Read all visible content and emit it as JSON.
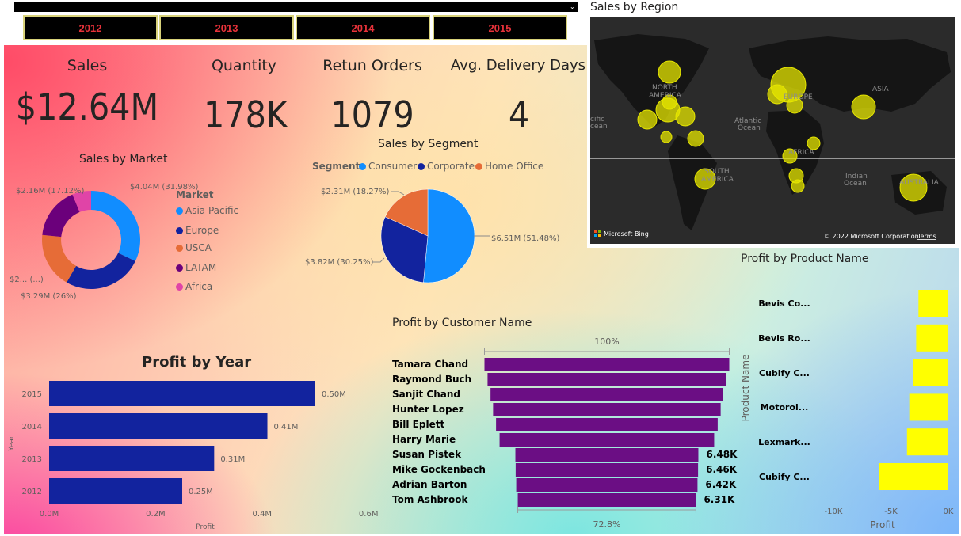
{
  "slicer": {
    "years": [
      "2012",
      "2013",
      "2014",
      "2015"
    ],
    "chevron": "⌄"
  },
  "kpis": [
    {
      "title": "Sales",
      "value": "$12.64M"
    },
    {
      "title": "Quantity",
      "value": "178K"
    },
    {
      "title": "Retun Orders",
      "value": "1079"
    },
    {
      "title": "Avg. Delivery Days",
      "value": "4"
    }
  ],
  "colors": {
    "asia_pacific": "#118DFF",
    "europe": "#12239E",
    "usca": "#E66C37",
    "latam": "#6B007B",
    "africa": "#E044A7",
    "bar_year": "#12239E",
    "bar_customer": "#6B0E84",
    "bar_product": "#FFFF00",
    "bubble": "#E6E600"
  },
  "chart_data": [
    {
      "type": "pie",
      "variant": "donut",
      "title": "Sales by Market",
      "legend_title": "Market",
      "legend_position": "right",
      "categories": [
        "Asia Pacific",
        "Europe",
        "USCA",
        "LATAM",
        "Africa"
      ],
      "values": [
        4.04,
        3.29,
        2.3,
        2.16,
        0.78
      ],
      "data_labels": [
        "$4.04M (31.98%)",
        "$3.29M (26%)",
        "$2... (...)",
        "$2.16M (17.12%)",
        ""
      ]
    },
    {
      "type": "pie",
      "title": "Sales by Segment",
      "legend_title": "Segment",
      "legend_position": "top",
      "categories": [
        "Consumer",
        "Corporate",
        "Home Office"
      ],
      "values": [
        6.51,
        3.82,
        2.31
      ],
      "data_labels": [
        "$6.51M (51.48%)",
        "$3.82M (30.25%)",
        "$2.31M (18.27%)"
      ]
    },
    {
      "type": "bar",
      "orientation": "horizontal",
      "title": "Profit by Year",
      "xlabel": "Profit",
      "ylabel": "Year",
      "categories": [
        "2015",
        "2014",
        "2013",
        "2012"
      ],
      "values": [
        0.5,
        0.41,
        0.31,
        0.25
      ],
      "data_labels": [
        "0.50M",
        "0.41M",
        "0.31M",
        "0.25M"
      ],
      "xlim": [
        0,
        0.6
      ],
      "x_ticks": [
        "0.0M",
        "0.2M",
        "0.4M",
        "0.6M"
      ],
      "grid": false
    },
    {
      "type": "bar",
      "variant": "funnel",
      "title": "Profit by Customer Name",
      "categories": [
        "Tamara Chand",
        "Raymond Buch",
        "Sanjit Chand",
        "Hunter Lopez",
        "Bill Eplett",
        "Harry Marie",
        "Susan Pistek",
        "Mike Gockenbach",
        "Adrian Barton",
        "Tom Ashbrook"
      ],
      "values": [
        8.67,
        8.45,
        8.24,
        8.06,
        7.85,
        7.6,
        6.48,
        6.46,
        6.42,
        6.31
      ],
      "data_labels": [
        "",
        "",
        "",
        "",
        "",
        "",
        "6.48K",
        "6.46K",
        "6.42K",
        "6.31K"
      ],
      "top_label": "100%",
      "bottom_label": "72.8%"
    },
    {
      "type": "bar",
      "orientation": "horizontal",
      "title": "Profit by Product Name",
      "xlabel": "Profit",
      "ylabel": "Product Name",
      "categories": [
        "Bevis Co...",
        "Bevis Ro...",
        "Cubify C...",
        "Motorol...",
        "Lexmark...",
        "Cubify C..."
      ],
      "values": [
        -2.6,
        -2.8,
        -3.1,
        -3.4,
        -3.6,
        -6.0
      ],
      "xlim": [
        -10,
        0
      ],
      "x_ticks": [
        "-10K",
        "-5K",
        "0K"
      ],
      "grid": false
    },
    {
      "type": "scatter",
      "variant": "bubble-map",
      "title": "Sales by Region",
      "labels": [
        "NORTH AMERICA",
        "EUROPE",
        "ASIA",
        "AFRICA",
        "SOUTH AMERICA",
        "AUSTRALIA",
        "Atlantic Ocean",
        "Indian Ocean",
        "Pacific Ocean"
      ],
      "attribution": "Microsoft Bing",
      "copyright": "© 2022 Microsoft Corporation",
      "terms": "Terms"
    }
  ],
  "map": {
    "title": "Sales by Region",
    "labels": {
      "north_america": "NORTH\nAMERICA",
      "europe": "EUROPE",
      "asia": "ASIA",
      "africa": "AFRICA",
      "south_america": "SOUTH\nAMERICA",
      "australia": "AUSTRALIA",
      "atlantic": "Atlantic\nOcean",
      "indian": "Indian\nOcean",
      "pacific": "Pacific\nOcean"
    },
    "bing": "Microsoft Bing",
    "copyright": "© 2022 Microsoft Corporation",
    "terms": "Terms"
  }
}
